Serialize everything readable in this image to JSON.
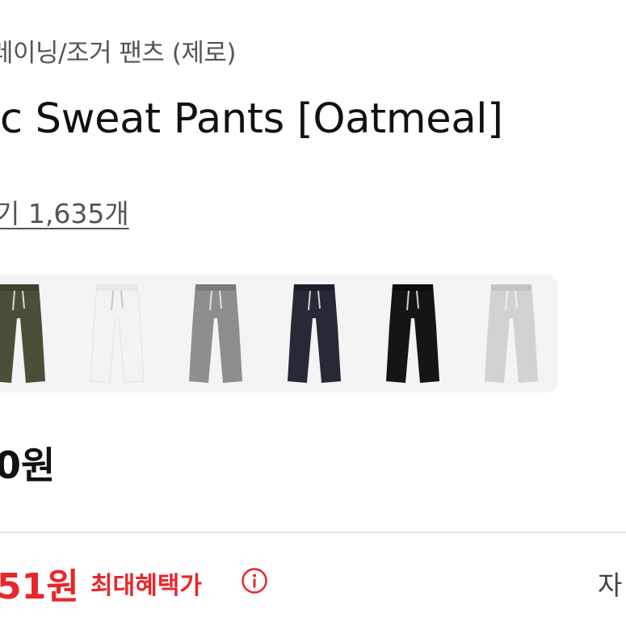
{
  "breadcrumb": {
    "category": "레이닝/조거 팬츠 (제로)"
  },
  "product": {
    "title": "c Sweat Pants [Oatmeal]",
    "reviews": "기 1,635개",
    "price": "0원"
  },
  "color_options": [
    {
      "name": "swatch-olive",
      "color": "#4a4f3a"
    },
    {
      "name": "swatch-white",
      "color": "#f3f3f3"
    },
    {
      "name": "swatch-gray",
      "color": "#8e8e8e"
    },
    {
      "name": "swatch-navy",
      "color": "#262a36"
    },
    {
      "name": "swatch-black",
      "color": "#151515"
    },
    {
      "name": "swatch-light-gray",
      "color": "#d2d2d2"
    }
  ],
  "benefit": {
    "price": "51원",
    "label": "최대혜택가",
    "icon": "info-icon",
    "right_text": "자"
  },
  "colors": {
    "accent": "#e8262b",
    "text": "#111111",
    "muted": "#555555"
  }
}
